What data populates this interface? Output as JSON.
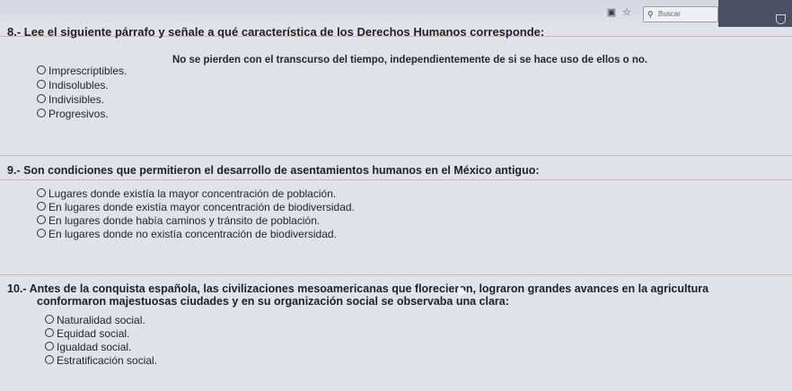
{
  "browser": {
    "search_placeholder": "Buscar"
  },
  "questions": [
    {
      "number": "8.-",
      "text": "Lee el siguiente párrafo y señale a qué característica de los Derechos Humanos corresponde:",
      "paragraph": "No se pierden con el transcurso del tiempo, independientemente de si se hace uso de ellos o no.",
      "options": [
        "Imprescriptibles.",
        "Indisolubles.",
        "Indivisibles.",
        "Progresivos."
      ]
    },
    {
      "number": "9.-",
      "text": "Son condiciones que permitieron el desarrollo de asentamientos humanos en el México antiguo:",
      "options": [
        "Lugares donde existía la mayor concentración de población.",
        "En lugares donde existía mayor concentración de biodiversidad.",
        "En lugares donde había caminos y tránsito de población.",
        "En lugares donde no existía concentración de biodiversidad."
      ]
    },
    {
      "number": "10.-",
      "text": "Antes de la conquista española, las civilizaciones mesoamericanas que florecieron, lograron grandes avances en la agricultura",
      "text2": "conformaron majestuosas ciudades y en su organización social se observaba una clara:",
      "options": [
        "Naturalidad social.",
        "Equidad social.",
        "Igualdad social.",
        "Estratificación social."
      ]
    }
  ]
}
